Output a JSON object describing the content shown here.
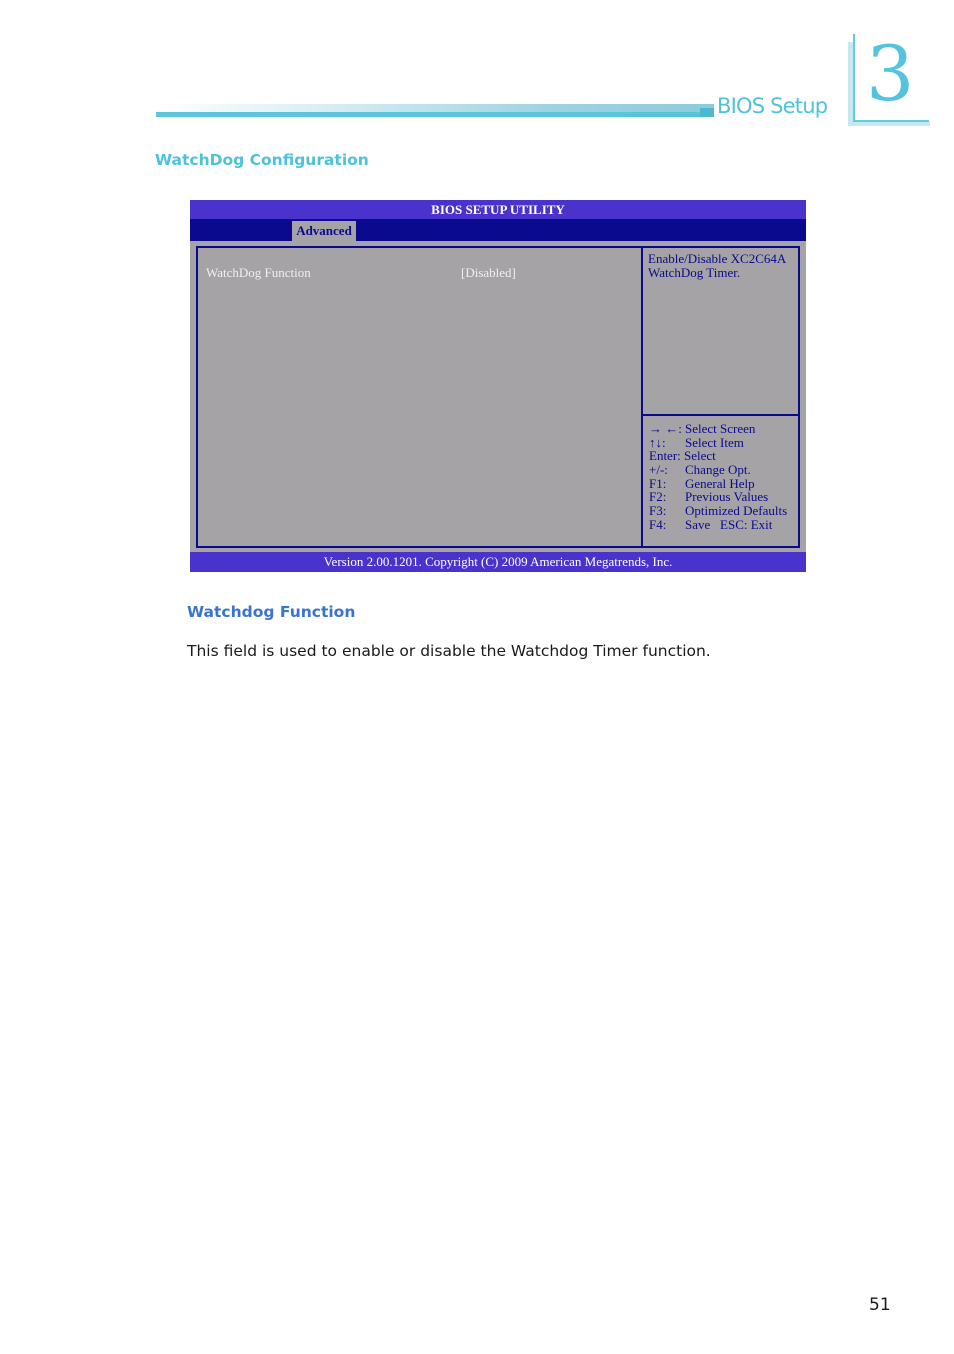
{
  "header": {
    "chapter_title": "BIOS Setup",
    "chapter_number": "3"
  },
  "section": {
    "title": "WatchDog Configuration"
  },
  "bios": {
    "title": "BIOS SETUP UTILITY",
    "active_tab": "Advanced",
    "options": [
      {
        "label": "WatchDog Function",
        "value": "[Disabled]"
      }
    ],
    "help_text": "Enable/Disable XC2C64A WatchDog Timer.",
    "keys": [
      {
        "key": "→ ←:",
        "desc": "Select Screen"
      },
      {
        "key": "↑↓:",
        "desc": "Select Item"
      },
      {
        "key": "Enter:",
        "desc": "Select"
      },
      {
        "key": "+/-:",
        "desc": "Change Opt."
      },
      {
        "key": "F1:",
        "desc": "General Help"
      },
      {
        "key": "F2:",
        "desc": "Previous Values"
      },
      {
        "key": "F3:",
        "desc": "Optimized Defaults"
      },
      {
        "key": "F4:",
        "desc": "Save   ESC: Exit"
      }
    ],
    "footer": "Version 2.00.1201. Copyright (C) 2009 American Megatrends, Inc."
  },
  "subsection": {
    "title": "Watchdog Function",
    "description": "This field is used to enable or disable the Watchdog Timer function."
  },
  "page_number": "51"
}
